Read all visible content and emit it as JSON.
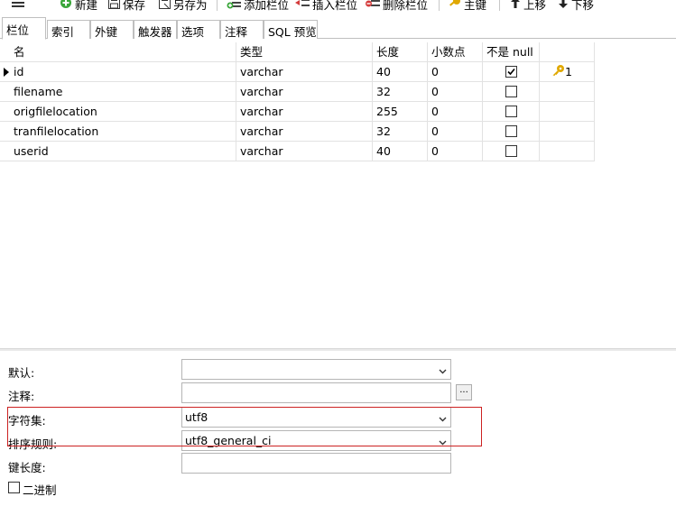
{
  "toolbar": {
    "menu_icon": "hamburger-icon",
    "buttons": [
      {
        "label": "新建",
        "icon": "new-icon"
      },
      {
        "label": "保存",
        "icon": "save-icon"
      },
      {
        "label": "另存为",
        "icon": "save-as-icon"
      },
      {
        "label": "添加栏位",
        "icon": "add-field-icon"
      },
      {
        "label": "插入栏位",
        "icon": "insert-field-icon"
      },
      {
        "label": "删除栏位",
        "icon": "delete-field-icon"
      },
      {
        "label": "主键",
        "icon": "key-icon"
      },
      {
        "label": "上移",
        "icon": "arrow-up-icon"
      },
      {
        "label": "下移",
        "icon": "arrow-down-icon"
      }
    ]
  },
  "tabs": [
    "栏位",
    "索引",
    "外键",
    "触发器",
    "选项",
    "注释",
    "SQL 预览"
  ],
  "active_tab": 0,
  "grid": {
    "headers": [
      "名",
      "类型",
      "长度",
      "小数点",
      "不是 null",
      ""
    ],
    "rows": [
      {
        "name": "id",
        "type": "varchar",
        "length": "40",
        "decimals": "0",
        "not_null": true,
        "key": "1"
      },
      {
        "name": "filename",
        "type": "varchar",
        "length": "32",
        "decimals": "0",
        "not_null": false,
        "key": ""
      },
      {
        "name": "origfilelocation",
        "type": "varchar",
        "length": "255",
        "decimals": "0",
        "not_null": false,
        "key": ""
      },
      {
        "name": "tranfilelocation",
        "type": "varchar",
        "length": "32",
        "decimals": "0",
        "not_null": false,
        "key": ""
      },
      {
        "name": "userid",
        "type": "varchar",
        "length": "40",
        "decimals": "0",
        "not_null": false,
        "key": ""
      }
    ]
  },
  "props": {
    "default_label": "默认:",
    "default_value": "",
    "comment_label": "注释:",
    "comment_value": "",
    "comment_button": "...",
    "charset_label": "字符集:",
    "charset_value": "utf8",
    "collation_label": "排序规则:",
    "collation_value": "utf8_general_ci",
    "keylength_label": "键长度:",
    "keylength_value": "",
    "binary_label": "二进制",
    "binary_checked": false
  },
  "colors": {
    "highlight_box": "#cc2222",
    "key_icon": "#e0a800",
    "add_icon": "#3aa63a",
    "delete_icon": "#d43c3c"
  }
}
